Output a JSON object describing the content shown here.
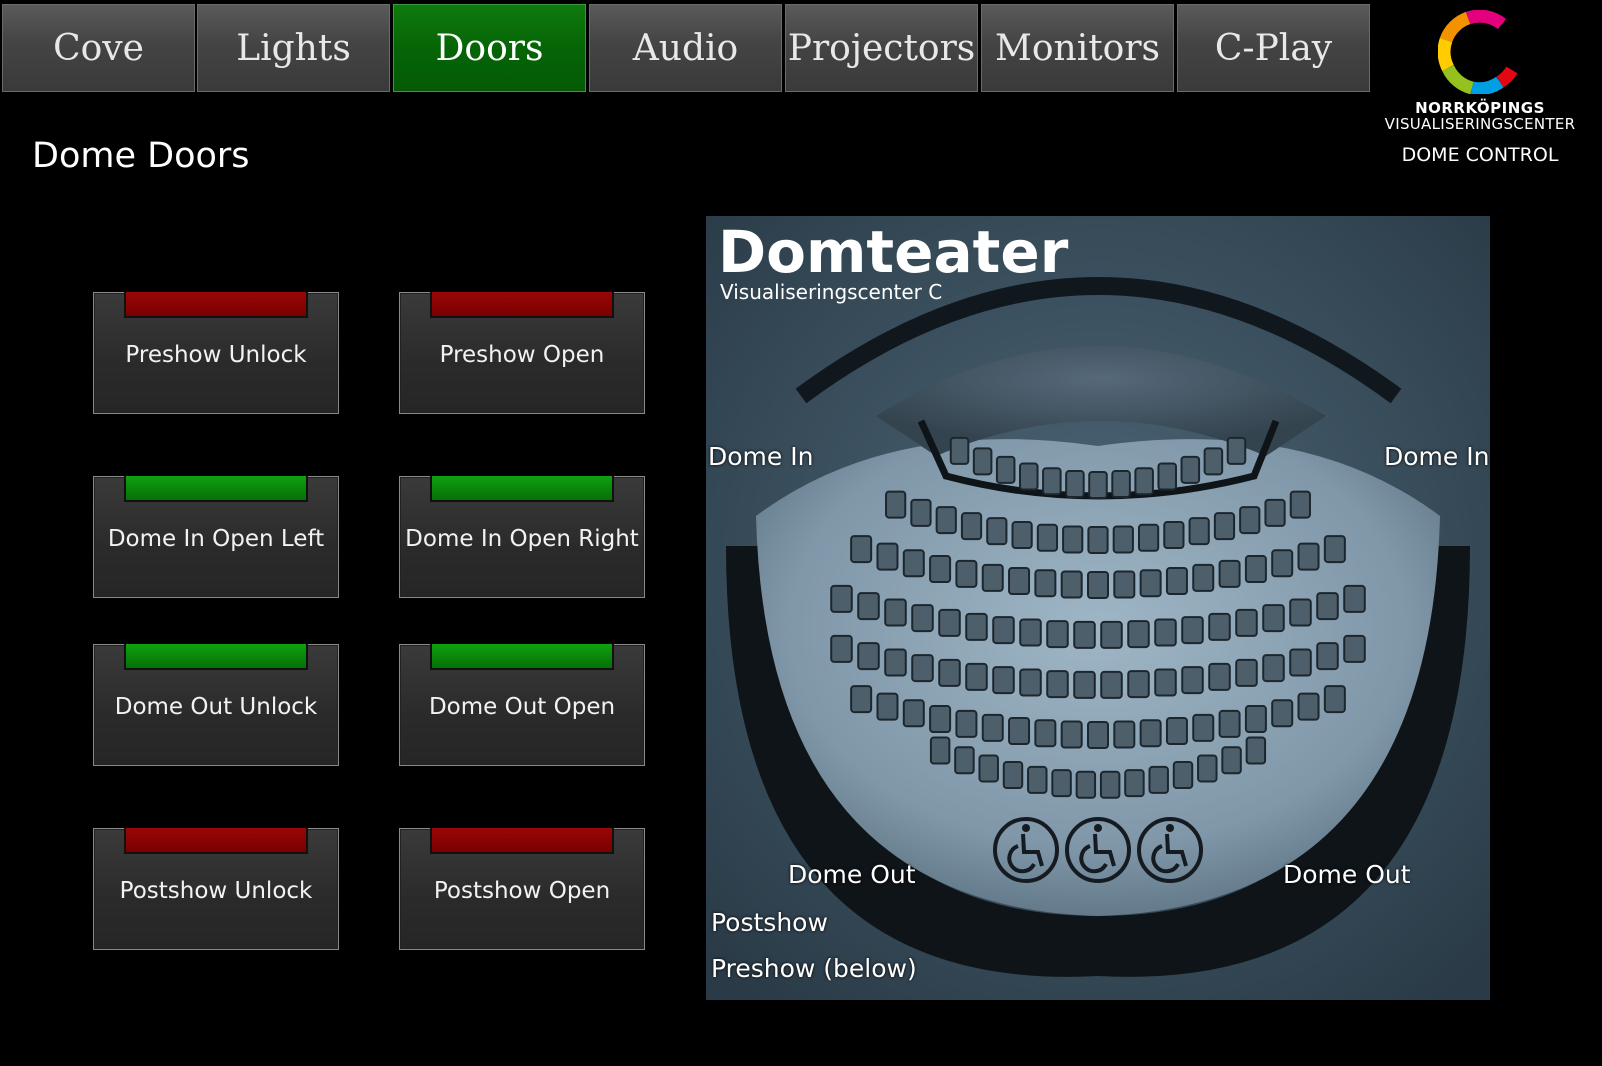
{
  "tabs": [
    {
      "label": "Cove",
      "active": false
    },
    {
      "label": "Lights",
      "active": false
    },
    {
      "label": "Doors",
      "active": true
    },
    {
      "label": "Audio",
      "active": false
    },
    {
      "label": "Projectors",
      "active": false
    },
    {
      "label": "Monitors",
      "active": false
    },
    {
      "label": "C-Play",
      "active": false
    }
  ],
  "logo": {
    "line1": "NORRKÖPINGS",
    "line2": "VISUALISERINGSCENTER",
    "line3": "DOME CONTROL"
  },
  "page_title": "Dome Doors",
  "buttons": [
    {
      "label": "Preshow Unlock",
      "status": "red"
    },
    {
      "label": "Preshow Open",
      "status": "red"
    },
    {
      "label": "Dome In Open Left",
      "status": "green"
    },
    {
      "label": "Dome In Open Right",
      "status": "green"
    },
    {
      "label": "Dome Out Unlock",
      "status": "green"
    },
    {
      "label": "Dome Out Open",
      "status": "green"
    },
    {
      "label": "Postshow Unlock",
      "status": "red"
    },
    {
      "label": "Postshow Open",
      "status": "red"
    }
  ],
  "colors": {
    "active_tab": "#066506",
    "status_red": "#8a0000",
    "status_green": "#088a08",
    "map_bg": "#3e5566"
  },
  "map": {
    "title": "Domteater",
    "subtitle": "Visualiseringscenter C",
    "labels": {
      "dome_in_left": "Dome In",
      "dome_in_right": "Dome In",
      "dome_out_left": "Dome Out",
      "dome_out_right": "Dome Out",
      "postshow": "Postshow",
      "preshow": "Preshow (below)"
    },
    "accessibility_icons": [
      "wheelchair-icon",
      "wheelchair-icon",
      "wheelchair-icon"
    ]
  }
}
